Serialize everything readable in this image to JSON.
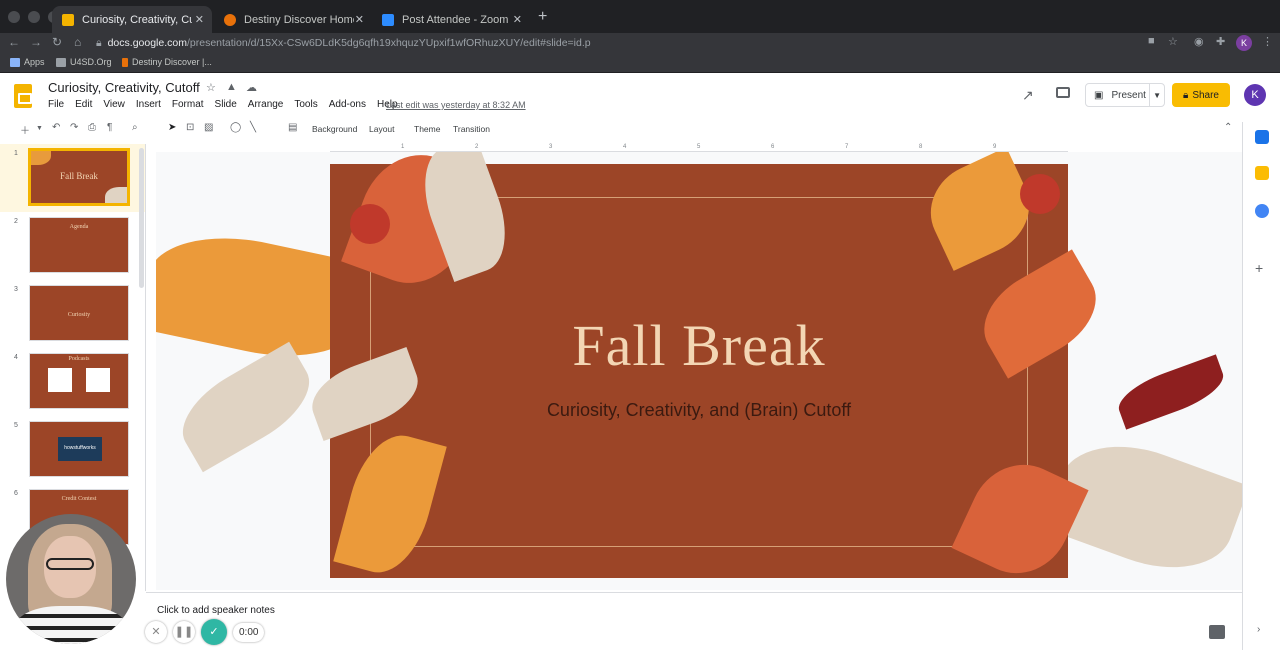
{
  "browser": {
    "tabs": [
      {
        "label": "Curiosity, Creativity, Cutoff",
        "color": "#f4b400"
      },
      {
        "label": "Destiny Discover Home",
        "color": "#e8710a"
      },
      {
        "label": "Post Attendee - Zoom",
        "color": "#2d8cff"
      }
    ],
    "url_host": "docs.google.com",
    "url_path": "/presentation/d/15Xx-CSw6DLdK5dg6qfh19xhquzYUpxif1wfORhuzXUY/edit#slide=id.p",
    "profile_initial": "K",
    "bookmarks": [
      "Apps",
      "U4SD.Org",
      "Destiny Discover |..."
    ]
  },
  "app": {
    "title": "Curiosity, Creativity, Cutoff",
    "menu": [
      "File",
      "Edit",
      "View",
      "Insert",
      "Format",
      "Slide",
      "Arrange",
      "Tools",
      "Add-ons",
      "Help"
    ],
    "last_edit": "Last edit was yesterday at 8:32 AM",
    "present_label": "Present",
    "share_label": "Share",
    "avatar_initial": "K"
  },
  "toolbar": {
    "background_label": "Background",
    "layout_label": "Layout",
    "theme_label": "Theme",
    "transition_label": "Transition"
  },
  "ruler_marks": [
    "1",
    "2",
    "3",
    "4",
    "5",
    "6",
    "7",
    "8",
    "9"
  ],
  "filmstrip": [
    {
      "num": "1",
      "title": "Fall Break"
    },
    {
      "num": "2",
      "title": "Agenda"
    },
    {
      "num": "3",
      "title": "Curiosity"
    },
    {
      "num": "4",
      "title": "Podcasts"
    },
    {
      "num": "5",
      "title": "howstuffworks"
    },
    {
      "num": "6",
      "title": "Credit Contest"
    }
  ],
  "slide": {
    "title": "Fall Break",
    "subtitle": "Curiosity, Creativity, and (Brain) Cutoff"
  },
  "notes": {
    "hint": "Click to add speaker notes"
  },
  "recorder": {
    "timer": "0:00"
  },
  "colors": {
    "slide_bg": "#9c4527",
    "accent": "#f4b400",
    "title": "#f3d6b4"
  }
}
